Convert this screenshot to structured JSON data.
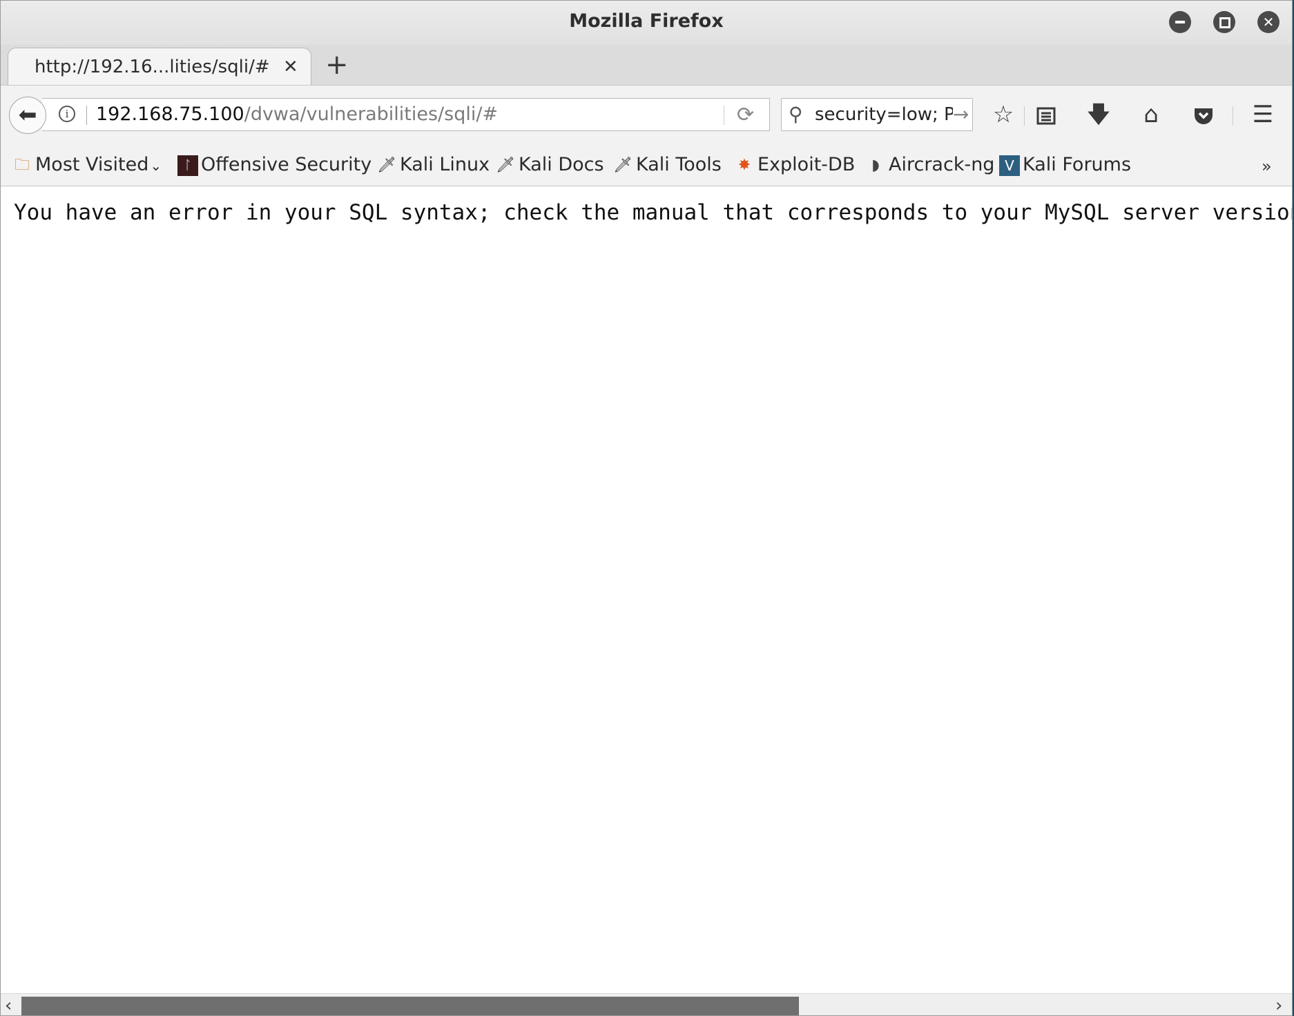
{
  "window": {
    "title": "Mozilla Firefox"
  },
  "tab": {
    "title": "http://192.16...lities/sqli/#",
    "close_glyph": "✕",
    "new_tab_glyph": "+"
  },
  "navbar": {
    "back_glyph": "🡐",
    "url_host": "192.168.75.100",
    "url_path": "/dvwa/vulnerabilities/sqli/#",
    "search_text": "security=low; P",
    "tools": [
      "star-icon",
      "reader-list-icon",
      "download-icon",
      "home-icon",
      "pocket-icon",
      "menu-icon"
    ]
  },
  "bookmarks": {
    "items": [
      {
        "label": "Most Visited",
        "icon": "folder-icon"
      },
      {
        "label": "Offensive Security",
        "icon": "offsec-icon"
      },
      {
        "label": "Kali Linux",
        "icon": "kali-dragon-icon"
      },
      {
        "label": "Kali Docs",
        "icon": "kali-dragon-icon"
      },
      {
        "label": "Kali Tools",
        "icon": "kali-dragon-icon"
      },
      {
        "label": "Exploit-DB",
        "icon": "exploitdb-bug-icon"
      },
      {
        "label": "Aircrack-ng",
        "icon": "aircrack-icon"
      },
      {
        "label": "Kali Forums",
        "icon": "kali-forums-icon"
      }
    ],
    "overflow_glyph": "»"
  },
  "content": {
    "error_message": "You have an error in your SQL syntax; check the manual that corresponds to your MySQL server version for"
  },
  "colors": {
    "chrome_bg": "#f2f2f2",
    "titlebar_bg": "#e6e6e6",
    "scroll_thumb": "#6f6f6f"
  }
}
